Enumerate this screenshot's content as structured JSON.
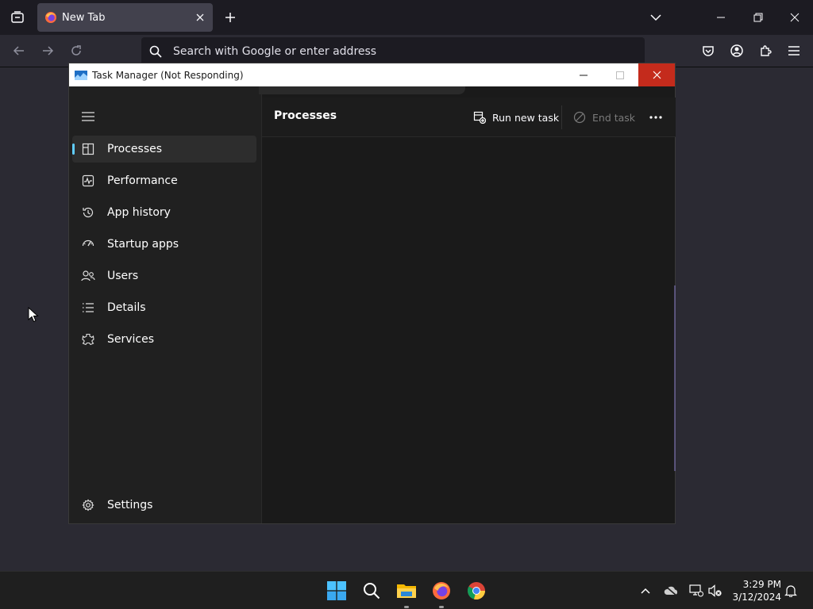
{
  "browser": {
    "tab_title": "New Tab",
    "url_placeholder": "Search with Google or enter address"
  },
  "task_manager": {
    "window_title": "Task Manager (Not Responding)",
    "page_title": "Processes",
    "run_new_task_label": "Run new task",
    "end_task_label": "End task",
    "nav_items": [
      {
        "label": "Processes",
        "icon": "processes-icon",
        "active": true
      },
      {
        "label": "Performance",
        "icon": "performance-icon"
      },
      {
        "label": "App history",
        "icon": "app-history-icon"
      },
      {
        "label": "Startup apps",
        "icon": "startup-apps-icon"
      },
      {
        "label": "Users",
        "icon": "users-icon"
      },
      {
        "label": "Details",
        "icon": "details-icon"
      },
      {
        "label": "Services",
        "icon": "services-icon"
      }
    ],
    "settings_label": "Settings"
  },
  "taskbar": {
    "time": "3:29 PM",
    "date": "3/12/2024"
  },
  "colors": {
    "accent": "#60cdff",
    "close_red": "#c42b1c"
  }
}
